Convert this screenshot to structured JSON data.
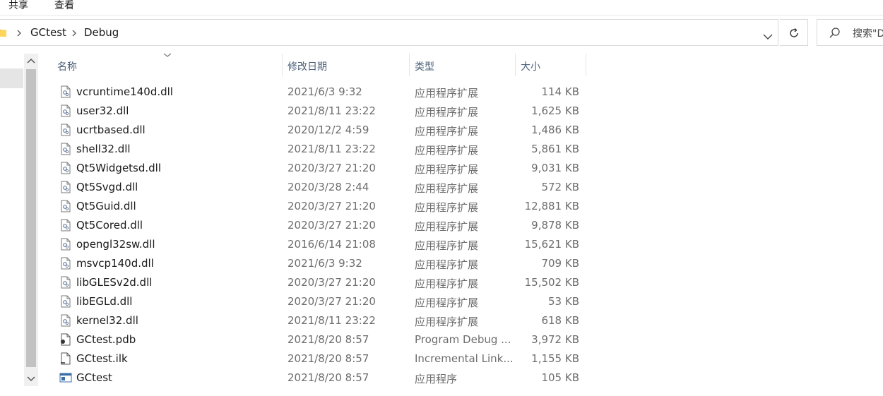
{
  "ribbon": {
    "tabs": [
      "共享",
      "查看"
    ]
  },
  "address": {
    "breadcrumbs": [
      "GCtest",
      "Debug"
    ]
  },
  "search": {
    "placeholder": "搜索\"D"
  },
  "columns": {
    "name": "名称",
    "date": "修改日期",
    "type": "类型",
    "size": "大小"
  },
  "files": [
    {
      "name": "vcruntime140d.dll",
      "date": "2021/6/3 9:32",
      "type": "应用程序扩展",
      "size": "114 KB",
      "icon": "dll-file-icon"
    },
    {
      "name": "user32.dll",
      "date": "2021/8/11 23:22",
      "type": "应用程序扩展",
      "size": "1,625 KB",
      "icon": "dll-file-icon"
    },
    {
      "name": "ucrtbased.dll",
      "date": "2020/12/2 4:59",
      "type": "应用程序扩展",
      "size": "1,486 KB",
      "icon": "dll-file-icon"
    },
    {
      "name": "shell32.dll",
      "date": "2021/8/11 23:22",
      "type": "应用程序扩展",
      "size": "5,861 KB",
      "icon": "dll-file-icon"
    },
    {
      "name": "Qt5Widgetsd.dll",
      "date": "2020/3/27 21:20",
      "type": "应用程序扩展",
      "size": "9,031 KB",
      "icon": "dll-file-icon"
    },
    {
      "name": "Qt5Svgd.dll",
      "date": "2020/3/28 2:44",
      "type": "应用程序扩展",
      "size": "572 KB",
      "icon": "dll-file-icon"
    },
    {
      "name": "Qt5Guid.dll",
      "date": "2020/3/27 21:20",
      "type": "应用程序扩展",
      "size": "12,881 KB",
      "icon": "dll-file-icon"
    },
    {
      "name": "Qt5Cored.dll",
      "date": "2020/3/27 21:20",
      "type": "应用程序扩展",
      "size": "9,878 KB",
      "icon": "dll-file-icon"
    },
    {
      "name": "opengl32sw.dll",
      "date": "2016/6/14 21:08",
      "type": "应用程序扩展",
      "size": "15,621 KB",
      "icon": "dll-file-icon"
    },
    {
      "name": "msvcp140d.dll",
      "date": "2021/6/3 9:32",
      "type": "应用程序扩展",
      "size": "709 KB",
      "icon": "dll-file-icon"
    },
    {
      "name": "libGLESv2d.dll",
      "date": "2020/3/27 21:20",
      "type": "应用程序扩展",
      "size": "15,502 KB",
      "icon": "dll-file-icon"
    },
    {
      "name": "libEGLd.dll",
      "date": "2020/3/27 21:20",
      "type": "应用程序扩展",
      "size": "53 KB",
      "icon": "dll-file-icon"
    },
    {
      "name": "kernel32.dll",
      "date": "2021/8/11 23:22",
      "type": "应用程序扩展",
      "size": "618 KB",
      "icon": "dll-file-icon"
    },
    {
      "name": "GCtest.pdb",
      "date": "2021/8/20 8:57",
      "type": "Program Debug ...",
      "size": "3,972 KB",
      "icon": "pdb-file-icon"
    },
    {
      "name": "GCtest.ilk",
      "date": "2021/8/20 8:57",
      "type": "Incremental Link...",
      "size": "1,155 KB",
      "icon": "generic-file-icon"
    },
    {
      "name": "GCtest",
      "date": "2021/8/20 8:57",
      "type": "应用程序",
      "size": "105 KB",
      "icon": "exe-file-icon"
    }
  ],
  "colors": {
    "header_text": "#4c607a",
    "secondary_text": "#6d6d6d",
    "scrollbar_thumb": "#c2c2c2",
    "folder": "#f2c94c"
  }
}
